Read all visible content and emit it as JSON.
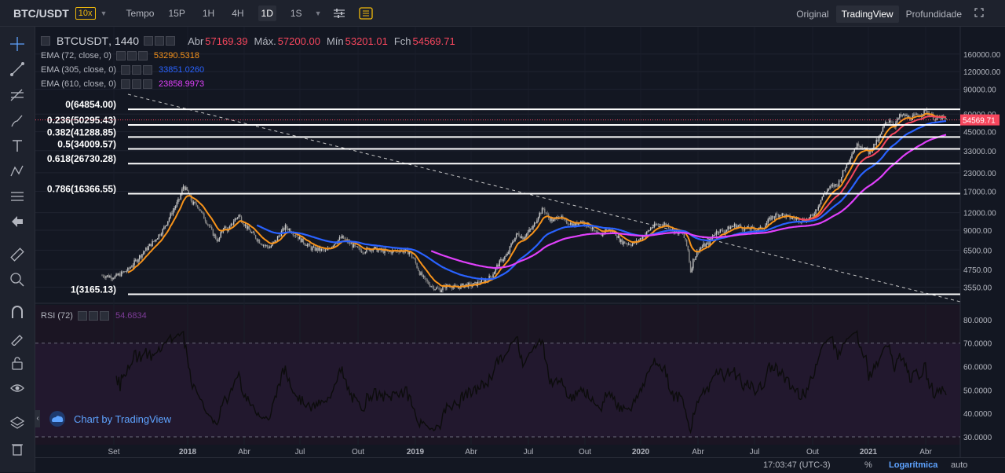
{
  "header": {
    "symbol": "BTC/USDT",
    "leverage": "10x",
    "time_label": "Tempo",
    "timeframes": [
      "15P",
      "1H",
      "4H",
      "1D",
      "1S"
    ],
    "active_timeframe": "1D",
    "views": [
      "Original",
      "TradingView",
      "Profundidade"
    ],
    "active_view": "TradingView"
  },
  "legend": {
    "symbol": "BTCUSDT",
    "interval": "1440",
    "open_label": "Abr",
    "open": "57169.39",
    "high_label": "Máx.",
    "high": "57200.00",
    "low_label": "Mín",
    "low": "53201.01",
    "close_label": "Fch",
    "close": "54569.71",
    "emas": [
      {
        "label": "EMA (72, close, 0)",
        "value": "53290.5318",
        "color": "#f7931a"
      },
      {
        "label": "EMA (305, close, 0)",
        "value": "33851.0260",
        "color": "#2962ff"
      },
      {
        "label": "EMA (610, close, 0)",
        "value": "23858.9973",
        "color": "#e040fb"
      }
    ],
    "rsi_label": "RSI (72)",
    "rsi_value": "54.6834"
  },
  "chart_data": {
    "type": "candlestick",
    "y_scale": "log",
    "price_ticks": [
      "160000.00",
      "120000.00",
      "90000.00",
      "60000.00",
      "45000.00",
      "33000.00",
      "23000.00",
      "17000.00",
      "12000.00",
      "9000.00",
      "6500.00",
      "4750.00",
      "3550.00"
    ],
    "current_price": "54569.71",
    "fib_levels": [
      {
        "label": "0(64854.00)",
        "price": 64854.0
      },
      {
        "label": "0.236(50295.43)",
        "price": 50295.43
      },
      {
        "label": "0.382(41288.85)",
        "price": 41288.85
      },
      {
        "label": "0.5(34009.57)",
        "price": 34009.57
      },
      {
        "label": "0.618(26730.28)",
        "price": 26730.28
      },
      {
        "label": "0.786(16366.55)",
        "price": 16366.55
      },
      {
        "label": "1(3165.13)",
        "price": 3165.13
      }
    ],
    "x_ticks": [
      "Set",
      "2018",
      "Abr",
      "Jul",
      "Out",
      "2019",
      "Abr",
      "Jul",
      "Out",
      "2020",
      "Abr",
      "Jul",
      "Out",
      "2021",
      "Abr"
    ],
    "rsi_ticks": [
      "80.0000",
      "70.0000",
      "60.0000",
      "50.0000",
      "40.0000",
      "30.0000"
    ],
    "price_path": [
      [
        0,
        4300
      ],
      [
        10,
        4200
      ],
      [
        20,
        4700
      ],
      [
        30,
        6000
      ],
      [
        40,
        7500
      ],
      [
        47,
        9000
      ],
      [
        54,
        12000
      ],
      [
        60,
        15000
      ],
      [
        63,
        18500
      ],
      [
        66,
        17000
      ],
      [
        70,
        14000
      ],
      [
        74,
        13500
      ],
      [
        78,
        11500
      ],
      [
        82,
        10000
      ],
      [
        86,
        8500
      ],
      [
        90,
        7500
      ],
      [
        94,
        9500
      ],
      [
        98,
        9000
      ],
      [
        102,
        10500
      ],
      [
        106,
        11500
      ],
      [
        110,
        10000
      ],
      [
        114,
        9000
      ],
      [
        118,
        8200
      ],
      [
        122,
        7500
      ],
      [
        126,
        7000
      ],
      [
        130,
        6800
      ],
      [
        134,
        7500
      ],
      [
        138,
        8500
      ],
      [
        142,
        9500
      ],
      [
        146,
        9000
      ],
      [
        150,
        8300
      ],
      [
        154,
        7700
      ],
      [
        158,
        7200
      ],
      [
        162,
        6700
      ],
      [
        166,
        6600
      ],
      [
        170,
        6500
      ],
      [
        174,
        6400
      ],
      [
        178,
        7000
      ],
      [
        182,
        7600
      ],
      [
        186,
        8000
      ],
      [
        190,
        7500
      ],
      [
        194,
        7000
      ],
      [
        198,
        6600
      ],
      [
        202,
        6400
      ],
      [
        206,
        6600
      ],
      [
        210,
        6700
      ],
      [
        214,
        6500
      ],
      [
        218,
        6400
      ],
      [
        222,
        6300
      ],
      [
        226,
        6400
      ],
      [
        230,
        6500
      ],
      [
        234,
        6400
      ],
      [
        238,
        6300
      ],
      [
        242,
        5500
      ],
      [
        246,
        4500
      ],
      [
        250,
        4000
      ],
      [
        254,
        3700
      ],
      [
        258,
        3500
      ],
      [
        262,
        3400
      ],
      [
        266,
        3600
      ],
      [
        270,
        3650
      ],
      [
        274,
        3500
      ],
      [
        278,
        3600
      ],
      [
        282,
        3700
      ],
      [
        286,
        3650
      ],
      [
        290,
        3750
      ],
      [
        294,
        3900
      ],
      [
        298,
        4000
      ],
      [
        302,
        4300
      ],
      [
        306,
        5000
      ],
      [
        310,
        5600
      ],
      [
        314,
        6000
      ],
      [
        318,
        7500
      ],
      [
        322,
        8500
      ],
      [
        326,
        8000
      ],
      [
        330,
        8700
      ],
      [
        334,
        9500
      ],
      [
        338,
        11500
      ],
      [
        342,
        12800
      ],
      [
        346,
        11000
      ],
      [
        350,
        10500
      ],
      [
        354,
        11500
      ],
      [
        358,
        10400
      ],
      [
        362,
        10200
      ],
      [
        366,
        9700
      ],
      [
        370,
        10500
      ],
      [
        374,
        10100
      ],
      [
        378,
        9600
      ],
      [
        382,
        8600
      ],
      [
        386,
        8200
      ],
      [
        390,
        9000
      ],
      [
        394,
        9000
      ],
      [
        398,
        8500
      ],
      [
        402,
        7500
      ],
      [
        406,
        7300
      ],
      [
        410,
        7200
      ],
      [
        414,
        7400
      ],
      [
        418,
        8000
      ],
      [
        422,
        8600
      ],
      [
        426,
        9500
      ],
      [
        430,
        9800
      ],
      [
        434,
        10000
      ],
      [
        438,
        9800
      ],
      [
        442,
        9000
      ],
      [
        446,
        8700
      ],
      [
        450,
        8500
      ],
      [
        454,
        6500
      ],
      [
        456,
        4600
      ],
      [
        458,
        5500
      ],
      [
        462,
        6500
      ],
      [
        466,
        7000
      ],
      [
        470,
        7200
      ],
      [
        474,
        8500
      ],
      [
        478,
        9000
      ],
      [
        482,
        8800
      ],
      [
        486,
        9400
      ],
      [
        490,
        9700
      ],
      [
        494,
        9600
      ],
      [
        498,
        9200
      ],
      [
        502,
        9300
      ],
      [
        506,
        9100
      ],
      [
        510,
        9200
      ],
      [
        514,
        9800
      ],
      [
        518,
        11000
      ],
      [
        522,
        11500
      ],
      [
        526,
        11700
      ],
      [
        530,
        11300
      ],
      [
        534,
        11000
      ],
      [
        538,
        10800
      ],
      [
        542,
        10600
      ],
      [
        546,
        10700
      ],
      [
        550,
        11300
      ],
      [
        554,
        13000
      ],
      [
        558,
        15500
      ],
      [
        562,
        17500
      ],
      [
        566,
        18500
      ],
      [
        570,
        19000
      ],
      [
        574,
        23000
      ],
      [
        578,
        28000
      ],
      [
        582,
        33000
      ],
      [
        586,
        37000
      ],
      [
        590,
        35000
      ],
      [
        594,
        32000
      ],
      [
        598,
        36000
      ],
      [
        602,
        40000
      ],
      [
        606,
        50000
      ],
      [
        610,
        55000
      ],
      [
        614,
        50000
      ],
      [
        618,
        58000
      ],
      [
        622,
        58500
      ],
      [
        626,
        56000
      ],
      [
        630,
        58000
      ],
      [
        634,
        60000
      ],
      [
        638,
        63500
      ],
      [
        642,
        59000
      ],
      [
        646,
        55000
      ],
      [
        650,
        57000
      ],
      [
        654,
        54569
      ]
    ]
  },
  "watermark": "Chart by TradingView",
  "status": {
    "time": "17:03:47 (UTC-3)",
    "percent": "%",
    "log": "Logarítmica",
    "auto": "auto"
  }
}
